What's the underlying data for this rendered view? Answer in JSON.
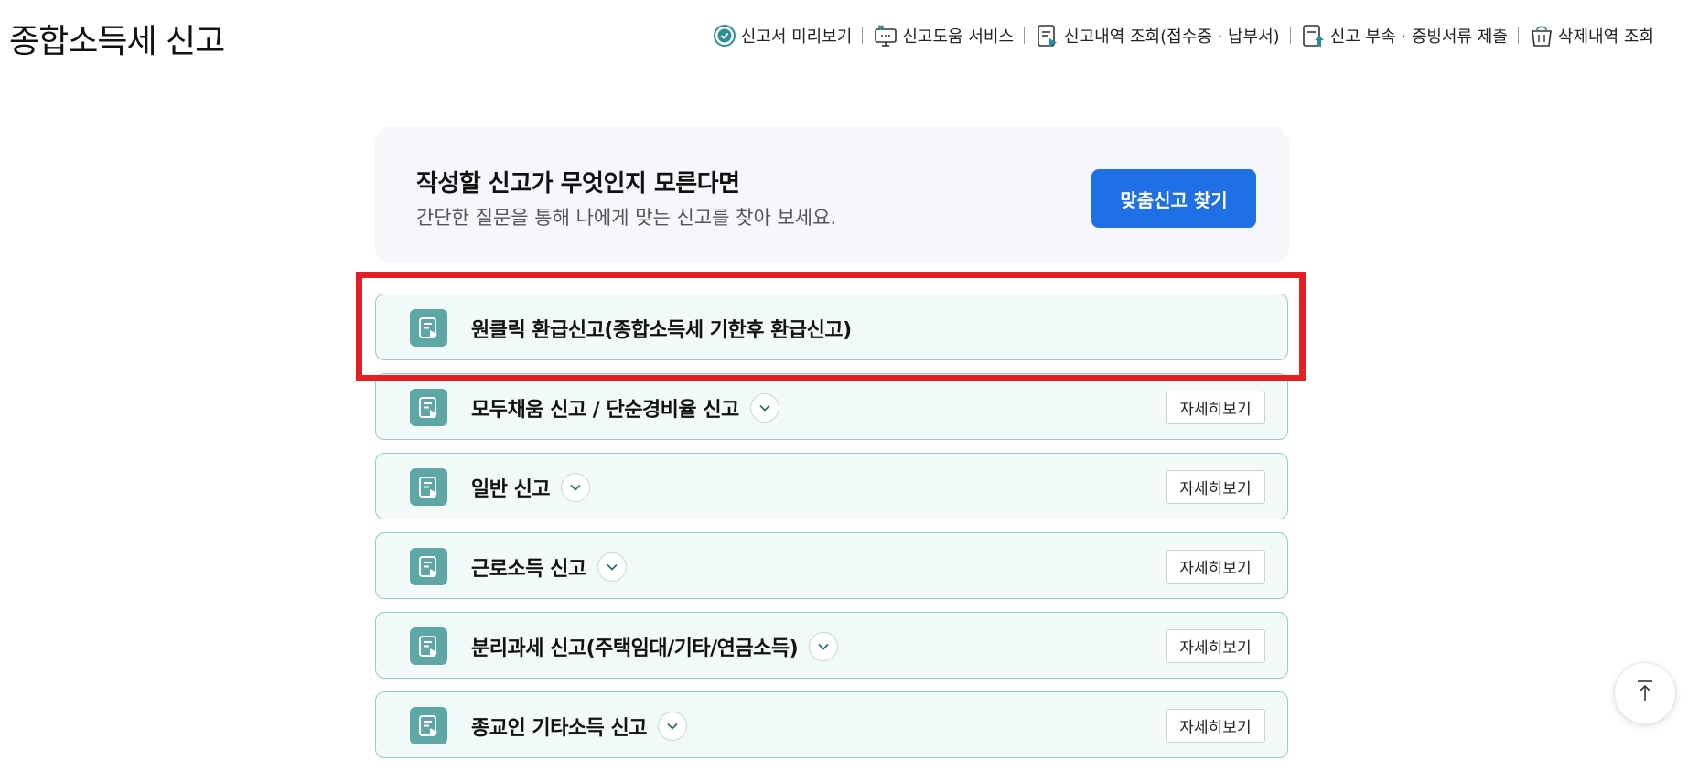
{
  "page": {
    "title": "종합소득세 신고"
  },
  "quick_links": [
    {
      "label": "신고서 미리보기",
      "icon": "check-circle-icon"
    },
    {
      "label": "신고도움 서비스",
      "icon": "help-monitor-icon"
    },
    {
      "label": "신고내역 조회(접수증 · 납부서)",
      "icon": "document-play-icon"
    },
    {
      "label": "신고 부속 · 증빙서류 제출",
      "icon": "document-upload-icon"
    },
    {
      "label": "삭제내역 조회",
      "icon": "trash-basket-icon"
    }
  ],
  "finder": {
    "title": "작성할 신고가 무엇인지 모른다면",
    "subtitle": "간단한 질문을 통해 나에게 맞는 신고를 찾아 보세요.",
    "button": "맞춤신고 찾기"
  },
  "reports": [
    {
      "label": "원클릭 환급신고(종합소득세 기한후 환급신고)",
      "has_toggle": false,
      "detail": "",
      "highlighted": true
    },
    {
      "label": "모두채움 신고 / 단순경비율 신고",
      "has_toggle": true,
      "detail": "자세히보기"
    },
    {
      "label": "일반 신고",
      "has_toggle": true,
      "detail": "자세히보기"
    },
    {
      "label": "근로소득 신고",
      "has_toggle": true,
      "detail": "자세히보기"
    },
    {
      "label": "분리과세 신고(주택임대/기타/연금소득)",
      "has_toggle": true,
      "detail": "자세히보기"
    },
    {
      "label": "종교인 기타소득 신고",
      "has_toggle": true,
      "detail": "자세히보기"
    }
  ],
  "colors": {
    "accent": "#1f6fe6",
    "teal_icon": "#5fa6a7",
    "item_border": "#8fcfcb",
    "item_bg": "#f2faf9",
    "highlight": "#e61f25"
  },
  "scroll_top_icon": "arrow-up-to-top-icon"
}
